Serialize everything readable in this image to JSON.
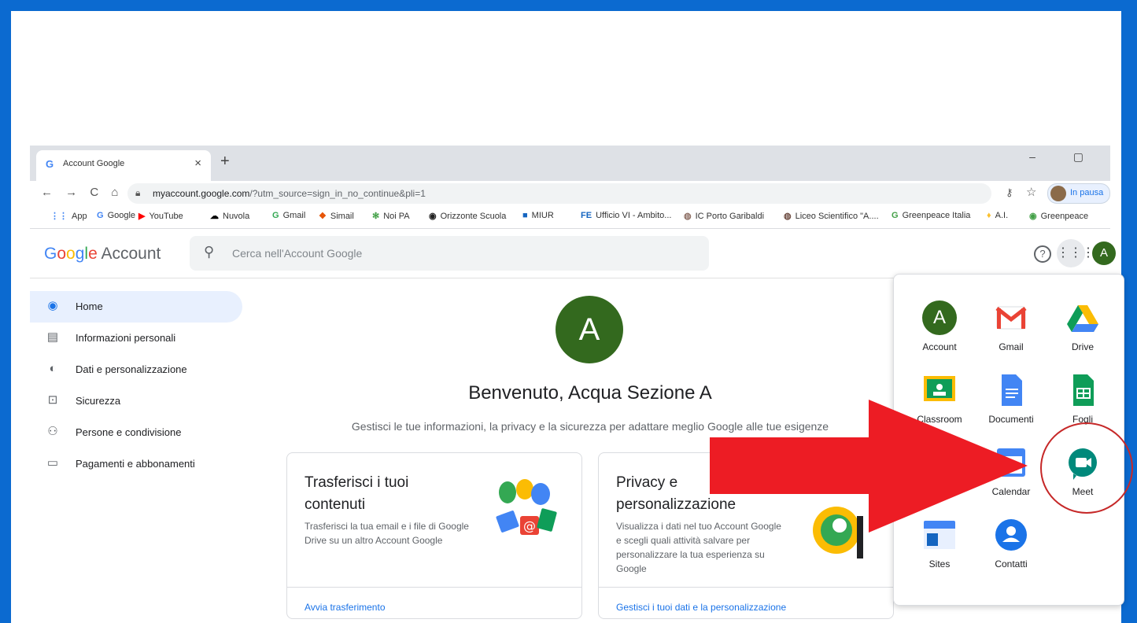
{
  "browser": {
    "tab_title": "Account Google",
    "tab_favicon": "G",
    "tab_close": "×",
    "new_tab": "+",
    "window_controls": "–  ▢",
    "url_host": "myaccount.google.com",
    "url_path": "/?utm_source=sign_in_no_continue&pli=1",
    "profile_label": "In pausa"
  },
  "bookmarks": [
    {
      "icon": "apps-grid-icon",
      "glyph": "⋮⋮",
      "color": "#4285f4",
      "label": "App"
    },
    {
      "icon": "google-icon",
      "glyph": "G",
      "color": "#4285f4",
      "label": "Google"
    },
    {
      "icon": "youtube-icon",
      "glyph": "▶",
      "color": "#ff0000",
      "label": "YouTube"
    },
    {
      "icon": "cloud-icon",
      "glyph": "☁",
      "color": "#000000",
      "label": "Nuvola"
    },
    {
      "icon": "gmail-icon",
      "glyph": "G",
      "color": "#34a853",
      "label": "Gmail"
    },
    {
      "icon": "simail-icon",
      "glyph": "❖",
      "color": "#e65100",
      "label": "Simail"
    },
    {
      "icon": "noipa-icon",
      "glyph": "✻",
      "color": "#43a047",
      "label": "Noi PA"
    },
    {
      "icon": "orizzonte-icon",
      "glyph": "◉",
      "color": "#222222",
      "label": "Orizzonte Scuola"
    },
    {
      "icon": "miur-icon",
      "glyph": "■",
      "color": "#1565c0",
      "label": "MIUR"
    },
    {
      "icon": "fe-icon",
      "glyph": "FE",
      "color": "#1565c0",
      "label": "Ufficio VI - Ambito..."
    },
    {
      "icon": "school-icon",
      "glyph": "◍",
      "color": "#8d6e63",
      "label": "IC Porto Garibaldi"
    },
    {
      "icon": "liceo-icon",
      "glyph": "◍",
      "color": "#6d4c41",
      "label": "Liceo Scientifico \"A...."
    },
    {
      "icon": "greenpeace-icon",
      "glyph": "G",
      "color": "#43a047",
      "label": "Greenpeace Italia"
    },
    {
      "icon": "ai-icon",
      "glyph": "♦",
      "color": "#fbc02d",
      "label": "A.I."
    },
    {
      "icon": "greenpeace2-icon",
      "glyph": "◉",
      "color": "#43a047",
      "label": "Greenpeace"
    }
  ],
  "header": {
    "logo_google": "Google",
    "logo_account": "Account",
    "search_placeholder": "Cerca nell'Account Google",
    "avatar_letter": "A"
  },
  "sidebar": {
    "items": [
      {
        "label": "Home",
        "icon": "home-icon",
        "glyph": "◉",
        "active": true
      },
      {
        "label": "Informazioni personali",
        "icon": "id-card-icon",
        "glyph": "▤",
        "active": false
      },
      {
        "label": "Dati e personalizzazione",
        "icon": "toggle-icon",
        "glyph": "◐",
        "active": false
      },
      {
        "label": "Sicurezza",
        "icon": "lock-icon",
        "glyph": "⊡",
        "active": false
      },
      {
        "label": "Persone e condivisione",
        "icon": "people-icon",
        "glyph": "⚇",
        "active": false
      },
      {
        "label": "Pagamenti e abbonamenti",
        "icon": "card-icon",
        "glyph": "▭",
        "active": false
      }
    ]
  },
  "main": {
    "avatar_letter": "A",
    "welcome": "Benvenuto, Acqua Sezione A",
    "subtitle": "Gestisci le tue informazioni, la privacy e la sicurezza per adattare meglio Google alle tue esigenze",
    "cards": [
      {
        "title": "Trasferisci i tuoi contenuti",
        "desc": "Trasferisci la tua email e i file di Google Drive su un altro Account Google",
        "link": "Avvia trasferimento"
      },
      {
        "title": "Privacy e personalizzazione",
        "desc": "Visualizza i dati nel tuo Account Google e scegli quali attività salvare per personalizzare la tua esperienza su Google",
        "link": "Gestisci i tuoi dati e la personalizzazione"
      }
    ]
  },
  "apps": [
    {
      "label": "Account",
      "icon": "account-icon",
      "color": "#33691e"
    },
    {
      "label": "Gmail",
      "icon": "gmail-icon",
      "color": "#ea4335"
    },
    {
      "label": "Drive",
      "icon": "drive-icon",
      "color": "#fbbc04"
    },
    {
      "label": "Classroom",
      "icon": "classroom-icon",
      "color": "#fbbc04"
    },
    {
      "label": "Documenti",
      "icon": "docs-icon",
      "color": "#4285f4"
    },
    {
      "label": "Fogli",
      "icon": "sheets-icon",
      "color": "#0f9d58"
    },
    {
      "label": "Calendar",
      "icon": "calendar-icon",
      "color": "#4285f4"
    },
    {
      "label": "Meet",
      "icon": "meet-icon",
      "color": "#00897b"
    },
    {
      "label": "Sites",
      "icon": "sites-icon",
      "color": "#4285f4"
    },
    {
      "label": "Contatti",
      "icon": "contacts-icon",
      "color": "#1a73e8"
    }
  ],
  "annotation": {
    "arrow_color": "#ed1c24",
    "circle_color": "#c62828"
  }
}
